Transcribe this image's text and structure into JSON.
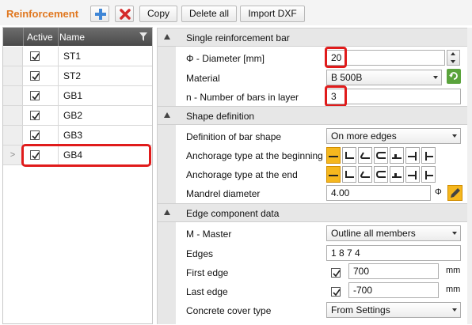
{
  "toolbar": {
    "title": "Reinforcement",
    "copy_label": "Copy",
    "delete_all_label": "Delete all",
    "import_dxf_label": "Import DXF"
  },
  "grid": {
    "columns": {
      "active": "Active",
      "name": "Name"
    },
    "rows": [
      {
        "name": "ST1",
        "active": true
      },
      {
        "name": "ST2",
        "active": true
      },
      {
        "name": "GB1",
        "active": true
      },
      {
        "name": "GB2",
        "active": true
      },
      {
        "name": "GB3",
        "active": true
      },
      {
        "name": "GB4",
        "active": true,
        "selected": true
      }
    ],
    "row_pointer": ">"
  },
  "sections": {
    "single_bar": {
      "title": "Single reinforcement bar",
      "diameter_label": "Φ - Diameter [mm]",
      "diameter_value": "20",
      "material_label": "Material",
      "material_value": "B 500B",
      "bars_label": "n - Number of bars in layer",
      "bars_value": "3"
    },
    "shape": {
      "title": "Shape definition",
      "definition_label": "Definition of bar shape",
      "definition_value": "On more edges",
      "anchor_begin_label": "Anchorage type at the beginning",
      "anchor_end_label": "Anchorage type at the end",
      "mandrel_label": "Mandrel diameter",
      "mandrel_value": "4.00",
      "mandrel_unit": "Φ"
    },
    "edge": {
      "title": "Edge component data",
      "master_label": "M - Master",
      "master_value": "Outline all members",
      "edges_label": "Edges",
      "edges_value": "1 8 7 4",
      "first_edge_label": "First edge",
      "first_edge_value": "700",
      "first_edge_unit": "mm",
      "last_edge_label": "Last edge",
      "last_edge_value": "-700",
      "last_edge_unit": "mm",
      "cover_label": "Concrete cover type",
      "cover_value": "From Settings"
    }
  },
  "colors": {
    "title_orange": "#e0771f",
    "highlight_red": "#e01b1b",
    "selected_anchor": "#f5b71e"
  }
}
